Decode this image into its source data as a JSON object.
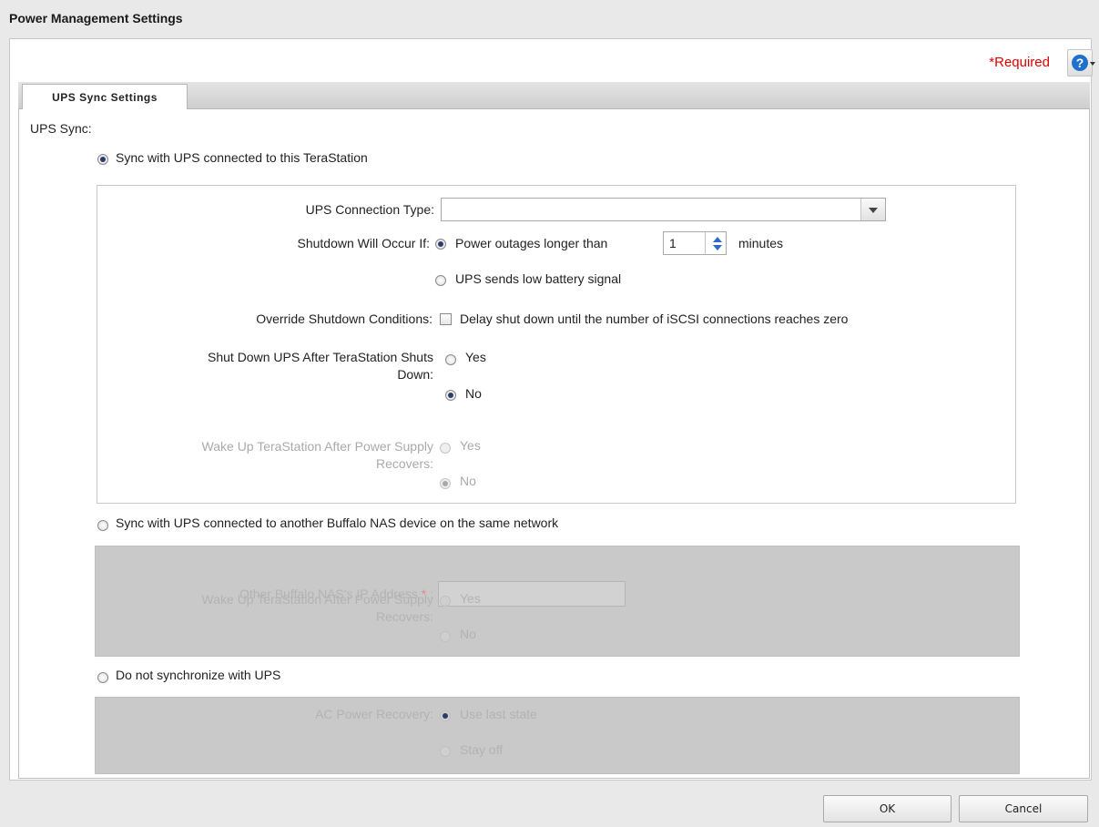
{
  "dialog": {
    "title": "Power Management Settings"
  },
  "header": {
    "required_label": "*Required",
    "help_glyph": "?"
  },
  "tabs": [
    {
      "label": "UPS Sync Settings"
    }
  ],
  "ups_sync": {
    "label": "UPS Sync:",
    "options": [
      {
        "label": "Sync with UPS connected to this TeraStation",
        "selected": true
      },
      {
        "label": "Sync with UPS connected to another Buffalo NAS device on the same network",
        "selected": false
      },
      {
        "label": "Do not synchronize with UPS",
        "selected": false
      }
    ]
  },
  "local_ups": {
    "connection_type": {
      "label": "UPS Connection Type:",
      "value": ""
    },
    "shutdown": {
      "label": "Shutdown Will Occur If:",
      "option_outage_prefix": "Power outages longer than",
      "outage_minutes": "1",
      "option_outage_suffix": "minutes",
      "option_low_battery": "UPS sends low battery signal",
      "selected": "outage"
    },
    "override": {
      "label": "Override Shutdown Conditions:",
      "checkbox_label": "Delay shut down until the number of iSCSI connections reaches zero",
      "checked": false
    },
    "shutdown_ups": {
      "label_line1": "Shut Down UPS After TeraStation Shuts",
      "label_line2": "Down:",
      "yes": "Yes",
      "no": "No",
      "selected": "No"
    },
    "wake_up": {
      "label_line1": "Wake Up TeraStation After Power Supply",
      "label_line2": "Recovers:",
      "yes": "Yes",
      "no": "No",
      "selected": "No",
      "disabled": true
    }
  },
  "remote_nas": {
    "ip": {
      "label": "Other Buffalo NAS's IP Address",
      "required_mark": "*",
      "colon": ":",
      "value": ""
    },
    "wake_up": {
      "label_line1": "Wake Up TeraStation After Power Supply",
      "label_line2": "Recovers:",
      "yes": "Yes",
      "no": "No"
    }
  },
  "no_sync": {
    "ac_recovery": {
      "label": "AC Power Recovery:",
      "use_last": "Use last state",
      "stay_off": "Stay off"
    }
  },
  "footer": {
    "ok_label": "OK",
    "cancel_label": "Cancel"
  },
  "colors": {
    "accent": "#1f6fcc",
    "required": "#e00000",
    "disabled_panel": "#c9c9c9"
  }
}
